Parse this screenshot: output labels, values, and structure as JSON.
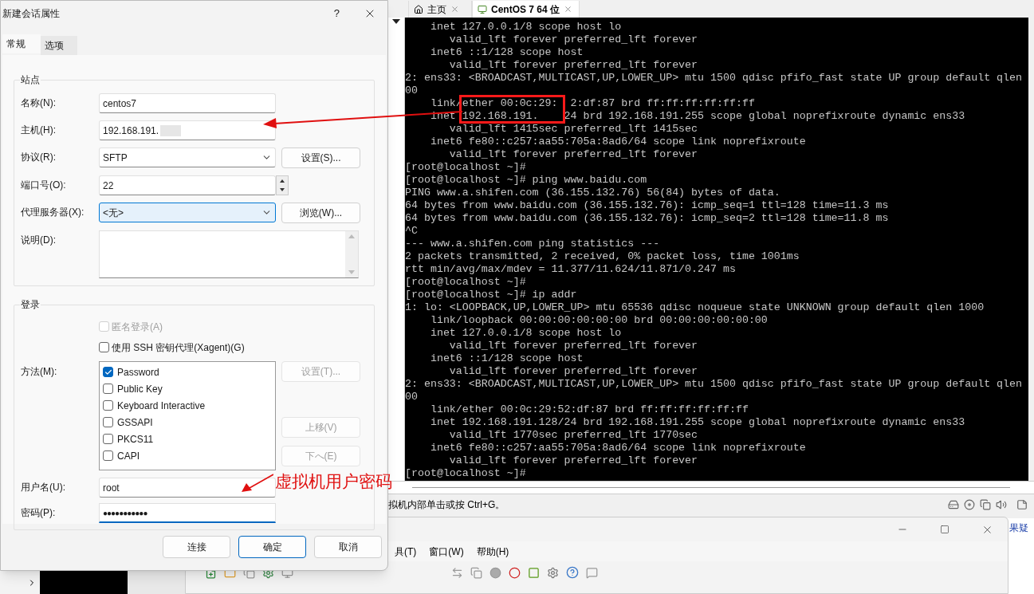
{
  "dialog": {
    "title": "新建会话属性",
    "help": "?",
    "tabs": [
      {
        "label": "常规",
        "selected": true
      },
      {
        "label": "选项",
        "selected": false
      }
    ],
    "site_group": {
      "title": "站点",
      "fields": [
        {
          "kind": "text",
          "label": "名称(N):",
          "value": "centos7"
        },
        {
          "kind": "text",
          "label": "主机(H):",
          "value": "192.168.191.",
          "redacted": true
        },
        {
          "kind": "select",
          "label": "协议(R):",
          "value": "SFTP",
          "button": "设置(S)..."
        },
        {
          "kind": "spin",
          "label": "端口号(O):",
          "value": "22"
        },
        {
          "kind": "select",
          "label": "代理服务器(X):",
          "value": "<无>",
          "button": "浏览(W)...",
          "focused": true
        },
        {
          "kind": "textarea",
          "label": "说明(D):"
        }
      ]
    },
    "login_group": {
      "title": "登录",
      "options": [
        {
          "label": "匿名登录(A)",
          "checked": false,
          "disabled": true
        },
        {
          "label": "使用 SSH 密钥代理(Xagent)(G)",
          "checked": false,
          "disabled": false
        }
      ],
      "method_label": "方法(M):",
      "methods": [
        {
          "label": "Password",
          "checked": true
        },
        {
          "label": "Public Key",
          "checked": false
        },
        {
          "label": "Keyboard Interactive",
          "checked": false
        },
        {
          "label": "GSSAPI",
          "checked": false
        },
        {
          "label": "PKCS11",
          "checked": false
        },
        {
          "label": "CAPI",
          "checked": false
        }
      ],
      "method_buttons": [
        {
          "label": "设置(T)...",
          "disabled": true
        },
        {
          "label": "上移(V)",
          "disabled": true
        },
        {
          "label": "下へ(E)",
          "disabled": true
        }
      ],
      "username": {
        "label": "用户名(U):",
        "value": "root"
      },
      "password": {
        "label": "密码(P):",
        "value": "●●●●●●●●●●●"
      }
    },
    "buttons": [
      {
        "label": "连接",
        "default": false
      },
      {
        "label": "确定",
        "default": true
      },
      {
        "label": "取消",
        "default": false
      }
    ]
  },
  "vmware": {
    "tabs": [
      {
        "label": "主页",
        "selected": false
      },
      {
        "label": "CentOS 7 64 位",
        "selected": true
      }
    ],
    "terminal": [
      "    inet 127.0.0.1/8 scope host lo",
      "       valid_lft forever preferred_lft forever",
      "    inet6 ::1/128 scope host",
      "       valid_lft forever preferred_lft forever",
      "2: ens33: <BROADCAST,MULTICAST,UP,LOWER_UP> mtu 1500 qdisc pfifo_fast state UP group default qlen",
      "00",
      "    link/ether 00:0c:29:  2:df:87 brd ff:ff:ff:ff:ff:ff",
      "    inet 192.168.191.    24 brd 192.168.191.255 scope global noprefixroute dynamic ens33",
      "       valid_lft 1415sec preferred_lft 1415sec",
      "    inet6 fe80::c257:aa55:705a:8ad6/64 scope link noprefixroute",
      "       valid_lft forever preferred_lft forever",
      "[root@localhost ~]#",
      "[root@localhost ~]# ping www.baidu.com",
      "PING www.a.shifen.com (36.155.132.76) 56(84) bytes of data.",
      "64 bytes from www.baidu.com (36.155.132.76): icmp_seq=1 ttl=128 time=11.3 ms",
      "64 bytes from www.baidu.com (36.155.132.76): icmp_seq=2 ttl=128 time=11.8 ms",
      "^C",
      "--- www.a.shifen.com ping statistics ---",
      "2 packets transmitted, 2 received, 0% packet loss, time 1001ms",
      "rtt min/avg/max/mdev = 11.377/11.624/11.871/0.247 ms",
      "[root@localhost ~]#",
      "[root@localhost ~]# ip addr",
      "1: lo: <LOOPBACK,UP,LOWER_UP> mtu 65536 qdisc noqueue state UNKNOWN group default qlen 1000",
      "    link/loopback 00:00:00:00:00:00 brd 00:00:00:00:00:00",
      "    inet 127.0.0.1/8 scope host lo",
      "       valid_lft forever preferred_lft forever",
      "    inet6 ::1/128 scope host",
      "       valid_lft forever preferred_lft forever",
      "2: ens33: <BROADCAST,MULTICAST,UP,LOWER_UP> mtu 1500 qdisc pfifo_fast state UP group default qlen",
      "00",
      "    link/ether 00:0c:29:52:df:87 brd ff:ff:ff:ff:ff:ff",
      "    inet 192.168.191.128/24 brd 192.168.191.255 scope global noprefixroute dynamic ens33",
      "       valid_lft 1770sec preferred_lft 1770sec",
      "    inet6 fe80::c257:aa55:705a:8ad6/64 scope link noprefixroute",
      "       valid_lft forever preferred_lft forever",
      "[root@localhost ~]#"
    ],
    "status": "拟机内部单击或按 Ctrl+G。"
  },
  "xshell": {
    "menus": [
      "具(T)",
      "窗口(W)",
      "帮助(H)"
    ],
    "side_link": "果疑"
  },
  "annotation": {
    "text": "虚拟机用户密码"
  }
}
